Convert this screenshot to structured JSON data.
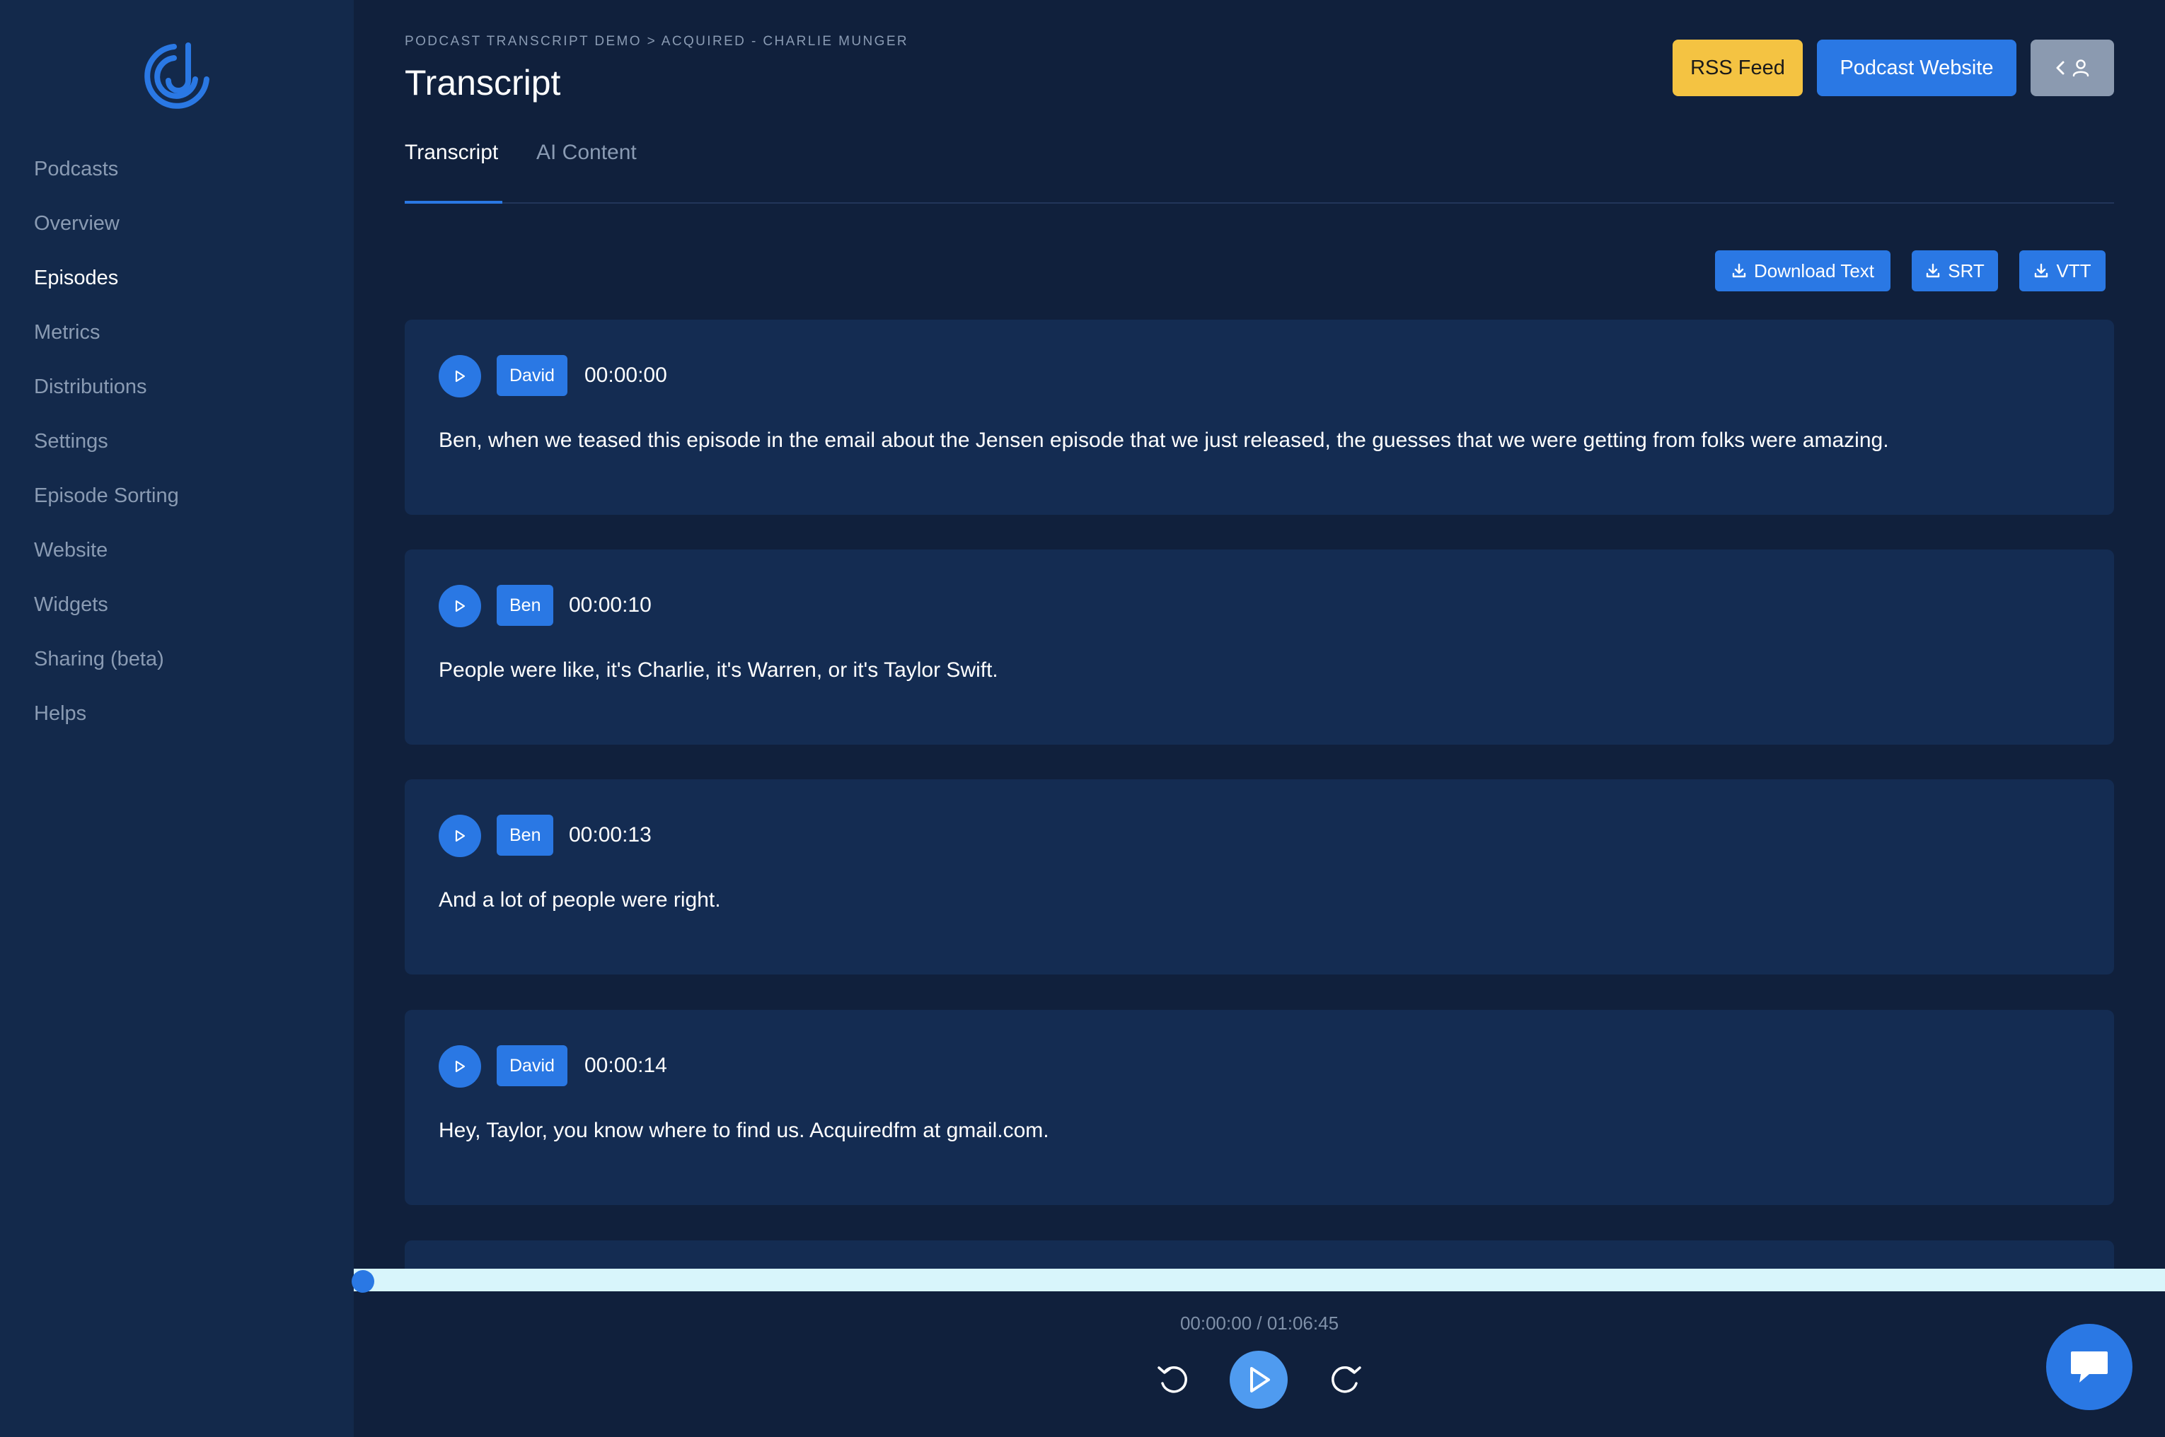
{
  "sidebar": {
    "items": [
      {
        "label": "Podcasts",
        "active": false
      },
      {
        "label": "Overview",
        "active": false
      },
      {
        "label": "Episodes",
        "active": true
      },
      {
        "label": "Metrics",
        "active": false
      },
      {
        "label": "Distributions",
        "active": false
      },
      {
        "label": "Settings",
        "active": false
      },
      {
        "label": "Episode Sorting",
        "active": false
      },
      {
        "label": "Website",
        "active": false
      },
      {
        "label": "Widgets",
        "active": false
      },
      {
        "label": "Sharing (beta)",
        "active": false
      },
      {
        "label": "Helps",
        "active": false
      }
    ]
  },
  "header": {
    "breadcrumb": "PODCAST TRANSCRIPT DEMO > ACQUIRED - CHARLIE MUNGER",
    "title": "Transcript",
    "rss_label": "RSS Feed",
    "website_label": "Podcast Website",
    "user_menu_icons": [
      "chevron-left-icon",
      "user-icon"
    ]
  },
  "tabs": [
    {
      "label": "Transcript",
      "active": true
    },
    {
      "label": "AI Content",
      "active": false
    }
  ],
  "downloads": {
    "text_label": "Download Text",
    "srt_label": "SRT",
    "vtt_label": "VTT"
  },
  "transcript": [
    {
      "speaker": "David",
      "time": "00:00:00",
      "text": "Ben, when we teased this episode in the email about the Jensen episode that we just released, the guesses that we were getting from folks were amazing."
    },
    {
      "speaker": "Ben",
      "time": "00:00:10",
      "text": "People were like, it's Charlie, it's Warren, or it's Taylor Swift."
    },
    {
      "speaker": "Ben",
      "time": "00:00:13",
      "text": "And a lot of people were right."
    },
    {
      "speaker": "David",
      "time": "00:00:14",
      "text": "Hey, Taylor, you know where to find us. Acquiredfm at gmail.com."
    }
  ],
  "player": {
    "time_readout": "00:00:00 / 01:06:45",
    "progress": 0.0
  },
  "colors": {
    "accent": "#2a78e4",
    "rss": "#f4c342",
    "sidebar_bg": "#13294b",
    "main_bg": "#10203c",
    "card_bg": "#142c52"
  }
}
